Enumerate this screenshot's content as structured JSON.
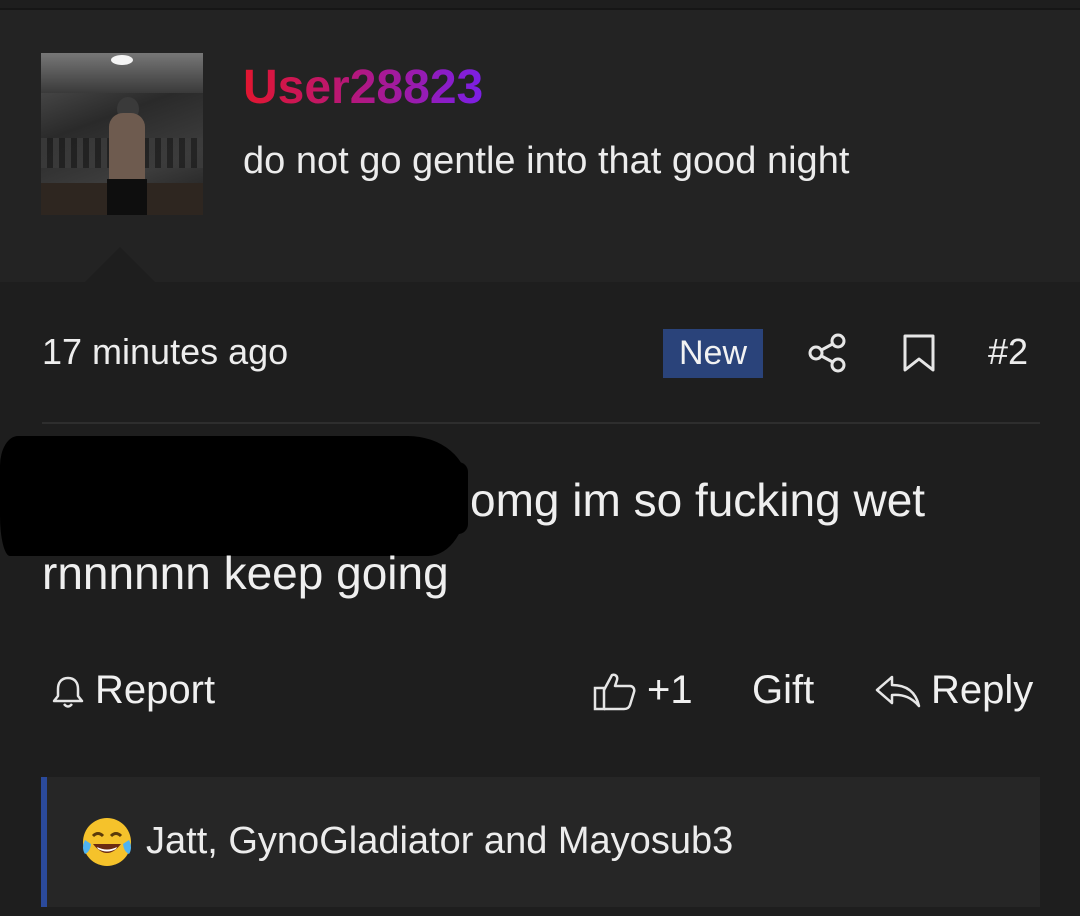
{
  "post": {
    "username": "User28823",
    "status_text": "do not go gentle into that good night",
    "avatar_icon": "profile-photo"
  },
  "comment": {
    "time": "17 minutes ago",
    "badge": "New",
    "number": "#2",
    "message_line1": "omg im so fucking wet",
    "message_line2": "rnnnnnn keep going",
    "redacted": true
  },
  "actions": {
    "report_label": "Report",
    "like_count": "+1",
    "gift_label": "Gift",
    "reply_label": "Reply"
  },
  "reactions": {
    "emoji": "laughing-crying-face",
    "text": "Jatt, GynoGladiator and Mayosub3"
  },
  "colors": {
    "background": "#1e1e1e",
    "header_background": "#232323",
    "badge_new": "#2a437a",
    "username_gradient": [
      "#e2162f",
      "#b5177a",
      "#7b1fe6"
    ],
    "reaction_bar": "#2b4a9b"
  }
}
